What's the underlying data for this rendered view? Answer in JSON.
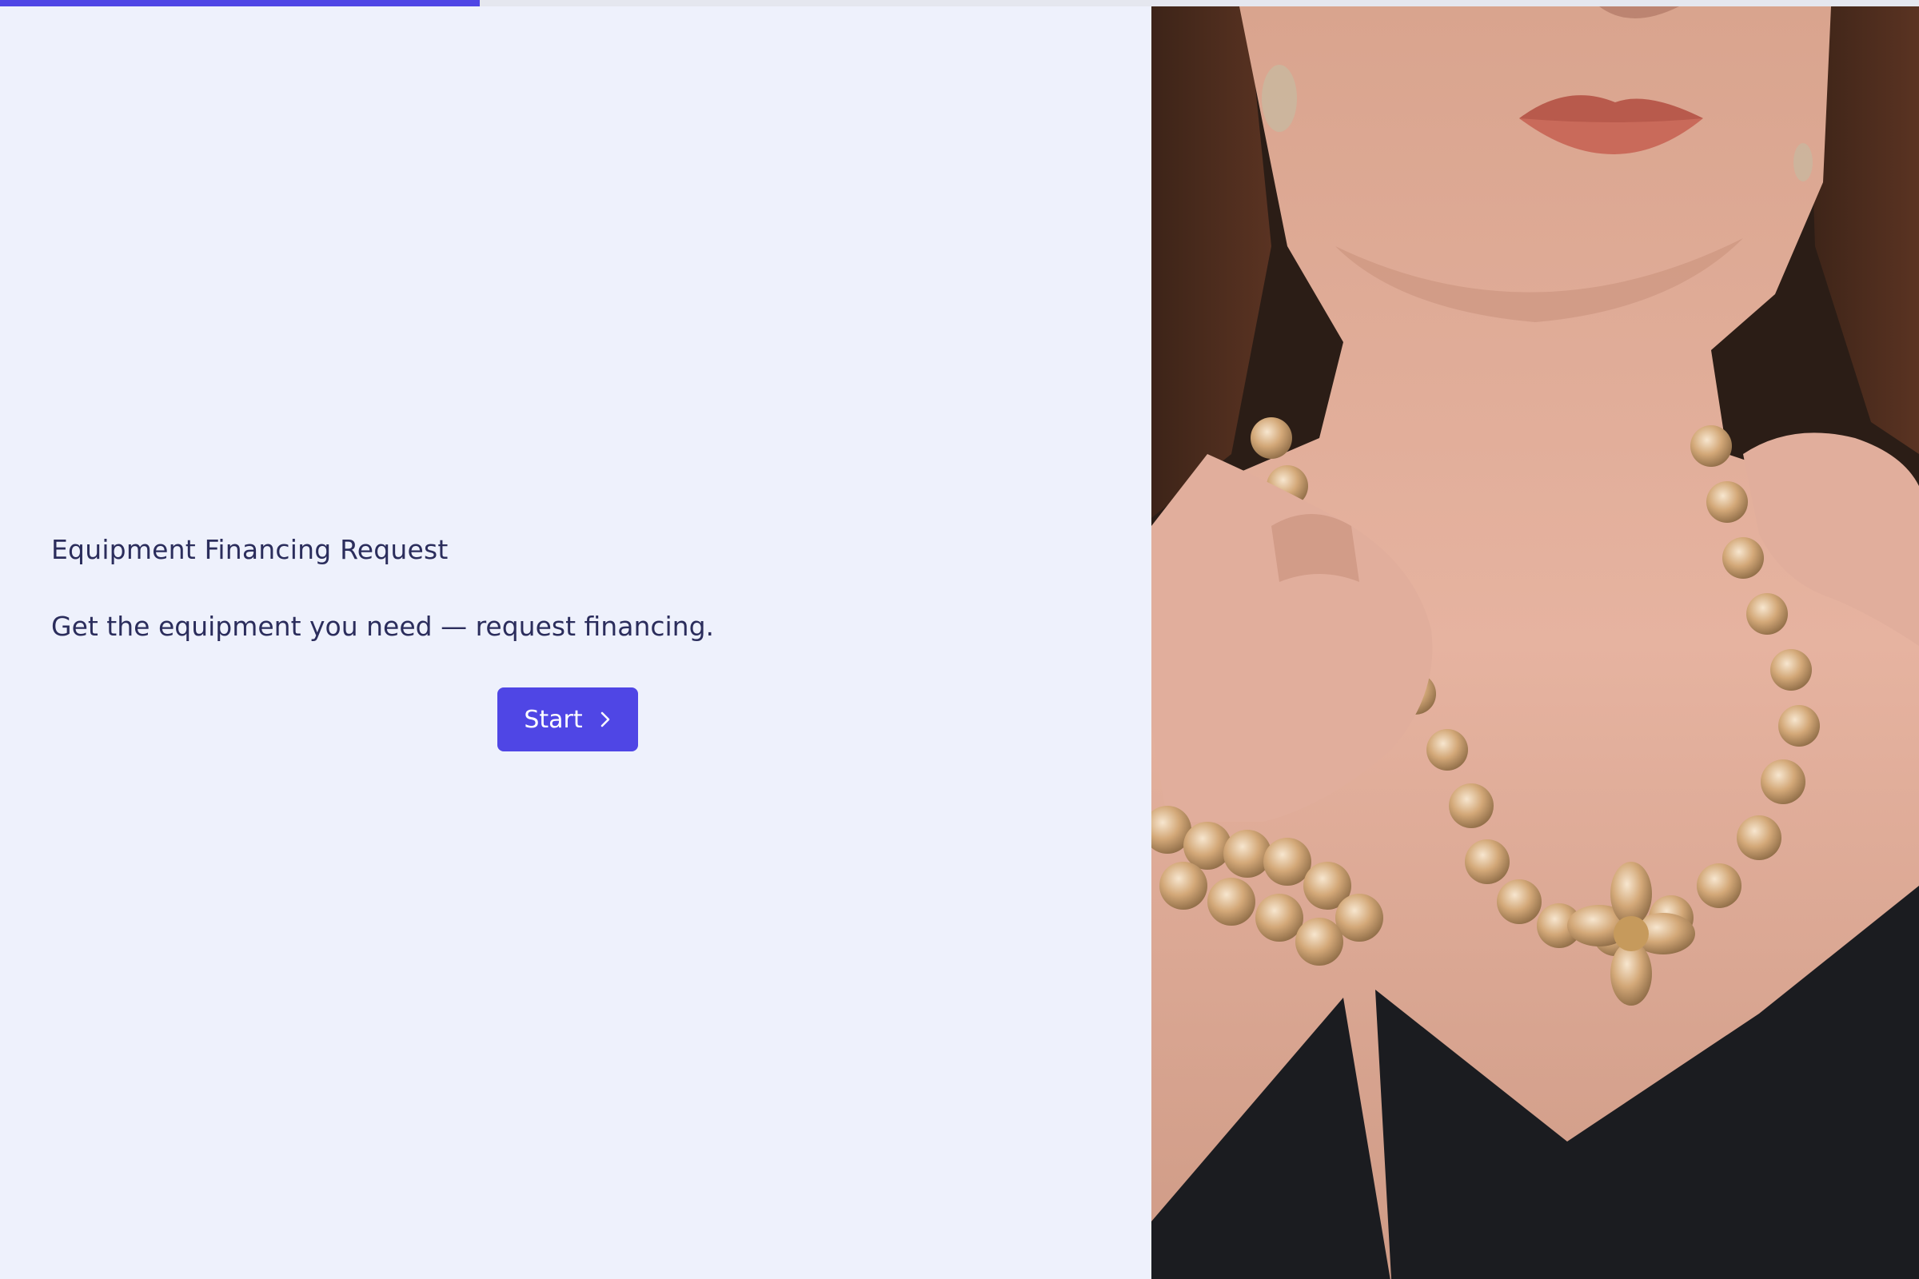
{
  "progress": {
    "fraction": 0.25,
    "color": "#4f46e5"
  },
  "form": {
    "title": "Equipment Financing Request",
    "subtitle": "Get the equipment you need — request financing.",
    "start_label": "Start",
    "start_icon": "chevron-right-icon"
  },
  "image": {
    "subject": "photo of woman wearing crystal necklace and bracelet"
  },
  "colors": {
    "accent": "#4f46e5",
    "background": "#eef1fc",
    "text": "#2b2d5c"
  }
}
